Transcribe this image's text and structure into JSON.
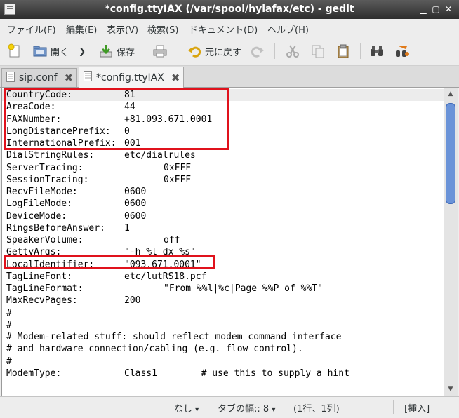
{
  "window": {
    "title": "*config.ttyIAX (/var/spool/hylafax/etc) - gedit"
  },
  "menu": [
    "ファイル(F)",
    "編集(E)",
    "表示(V)",
    "検索(S)",
    "ドキュメント(D)",
    "ヘルプ(H)"
  ],
  "toolbar": {
    "open_label": "開く",
    "save_label": "保存",
    "undo_label": "元に戻す"
  },
  "tabs": [
    {
      "label": "sip.conf"
    },
    {
      "label": "*config.ttyIAX"
    }
  ],
  "editor": {
    "lines": [
      {
        "k": "CountryCode:",
        "v": "81"
      },
      {
        "k": "AreaCode:",
        "v": "44"
      },
      {
        "k": "FAXNumber:",
        "v": "+81.093.671.0001"
      },
      {
        "k": "LongDistancePrefix:",
        "v": "0"
      },
      {
        "k": "InternationalPrefix:",
        "v": "001"
      },
      {
        "k": "DialStringRules:",
        "v": "etc/dialrules"
      },
      {
        "k": "ServerTracing:",
        "v": "0xFFF",
        "indent": true
      },
      {
        "k": "SessionTracing:",
        "v": "0xFFF",
        "indent": true
      },
      {
        "k": "RecvFileMode:",
        "v": "0600"
      },
      {
        "k": "LogFileMode:",
        "v": "0600"
      },
      {
        "k": "DeviceMode:",
        "v": "0600"
      },
      {
        "k": "RingsBeforeAnswer:",
        "v": "1"
      },
      {
        "k": "SpeakerVolume:",
        "v": "off",
        "indent": true
      },
      {
        "k": "GettyArgs:",
        "v": "\"-h %l dx %s\""
      },
      {
        "k": "LocalIdentifier:",
        "v": "\"093.671.0001\""
      },
      {
        "k": "TagLineFont:",
        "v": "etc/lutRS18.pcf"
      },
      {
        "k": "TagLineFormat:",
        "v": "\"From %%l|%c|Page %%P of %%T\"",
        "indent": true
      },
      {
        "k": "MaxRecvPages:",
        "v": "200"
      },
      {
        "k": "#",
        "v": ""
      },
      {
        "k": "#",
        "v": ""
      },
      {
        "k": "# Modem-related stuff: should reflect modem command interface",
        "v": ""
      },
      {
        "k": "# and hardware connection/cabling (e.g. flow control).",
        "v": ""
      },
      {
        "k": "#",
        "v": ""
      },
      {
        "k": "ModemType:",
        "v": "Class1        # use this to supply a hint"
      }
    ]
  },
  "status": {
    "lang": "なし",
    "tab_width": "タブの幅:: 8",
    "position": "(1行、1列)",
    "mode": "[挿入]"
  },
  "colors": {
    "highlight": "#e0121c",
    "scrollbar_thumb": "#6a93d8"
  }
}
